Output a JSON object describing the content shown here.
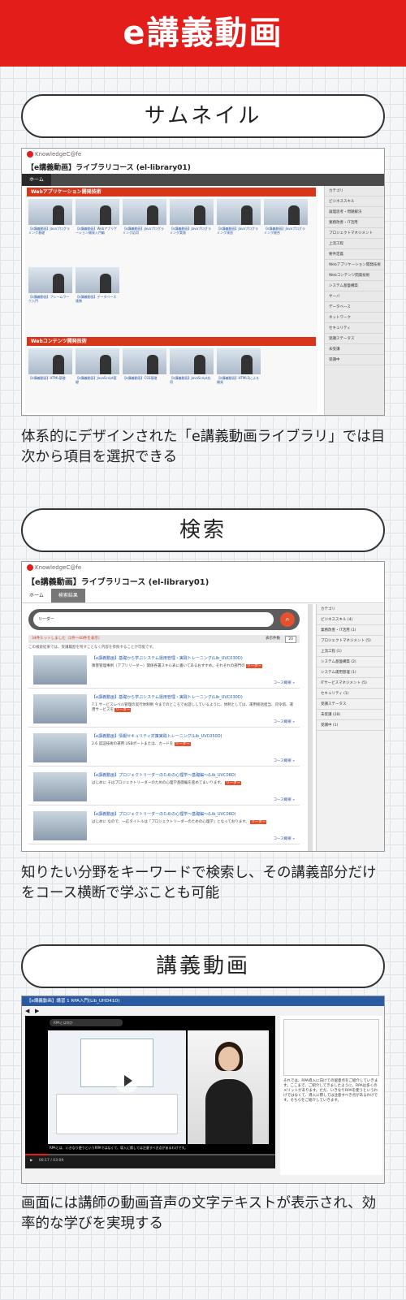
{
  "page": {
    "title": "e講義動画",
    "accent": "#e31d1a"
  },
  "sections": [
    {
      "heading": "サムネイル",
      "caption": "体系的にデザインされた「e講義動画ライブラリ」では目次から項目を選択できる"
    },
    {
      "heading": "検索",
      "caption": "知りたい分野をキーワードで検索し、その講義部分だけをコース横断で学ぶことも可能"
    },
    {
      "heading": "講義動画",
      "caption": "画面には講師の動画音声の文字テキストが表示され、効率的な学びを実現する"
    }
  ],
  "screen1": {
    "brand": "KnowledgeC@fe",
    "course_title": "【e講義動画】ライブラリコース (el-library01)",
    "tab_home": "ホーム",
    "section_a": "Webアプリケーション開発技術",
    "section_b": "Webコンテンツ開発技術",
    "thumbs_a": [
      "【e講義動画】Javaプログラミング基礎",
      "【e講義動画】Webアプリケーション開発入門編",
      "【e講義動画】Javaプログラミング応用",
      "【e講義動画】Javaプログラミング実践",
      "【e講義動画】Javaプログラミング演習",
      "【e講義動画】Javaプログラミング総合",
      "【e講義動画】フレームワーク入門",
      "【e講義動画】データベース連携"
    ],
    "thumbs_b": [
      "【e講義動画】HTML基礎",
      "【e講義動画】JavaScript基礎",
      "【e講義動画】CSS基礎",
      "【e講義動画】JavaScript応用",
      "【e講義動画】HTML5による開発"
    ],
    "sidebar": [
      "カテゴリ",
      "ビジネススキル",
      "論理思考・問題解決",
      "業務改善・IT活用",
      "プロジェクトマネジメント",
      "上流工程",
      "要件定義",
      "Webアプリケーション開発技術",
      "Webコンテンツ開発技術",
      "システム基盤構築",
      "サーバ",
      "データベース",
      "ネットワーク",
      "セキュリティ",
      "受講ステータス",
      "未受講",
      "受講中"
    ]
  },
  "screen2": {
    "brand": "KnowledgeC@fe",
    "course_title": "【e講義動画】ライブラリコース (el-library01)",
    "tab_home": "ホーム",
    "tab_results": "検索結果",
    "search_value": "リーダー",
    "result_count": "34件ヒットしました（1件～40件を表示）",
    "display_count_label": "表示件数",
    "display_count": "20",
    "note": "この検索結果では、受講履歴を残すことなく内容を参照することが可能です。",
    "rows": [
      {
        "title": "【e講義動画】基礎から学ぶシステム運用管理・実践トレーニング(Lib_UVC030D)",
        "text": "障害管理事例（アプリリーダー）関係各署スキル表に書いてあるおすすめ。それぞれの部門の",
        "hl": "リーダー",
        "link": "コース概要 »"
      },
      {
        "title": "【e講義動画】基礎から学ぶシステム運用管理・実践トレーニング(Lib_UVC030D)",
        "text": "7.1 サービスレベル管理の実行体制例 今までのところでお話ししているように、体制としては、運用統括担当、司令塔、運用サービスを",
        "hl": "リーダー",
        "link": "コース概要 »"
      },
      {
        "title": "【e講義動画】情報セキュリティ対策実践トレーニング(Lib_UVC050D)",
        "text": "2.6 認証技術の運用 USBポートまたは、カードを",
        "hl": "リーダー",
        "link": "コース概要 »"
      },
      {
        "title": "【e講義動画】プロジェクトリーダーのための心理学～基礎編～(Lib_UVC06D)",
        "text": "はじめに そはプロジェクトリーダーのための心理学基礎編を進めてまいります。",
        "hl": "リーダー",
        "link": "コース概要 »"
      },
      {
        "title": "【e講義動画】プロジェクトリーダーのための心理学～基礎編～(Lib_UVC06D)",
        "text": "はじめに なので、一応タイトルは「プロジェクトリーダーのための心理学」となっております。",
        "hl": "リーダー",
        "link": "コース概要 »"
      }
    ],
    "sidebar": [
      "カテゴリ",
      "ビジネススキル (4)",
      "業務改善・IT活用 (1)",
      "プロジェクトマネジメント (5)",
      "上流工程 (1)",
      "システム基盤構築 (2)",
      "システム運用管理 (1)",
      "ITサービスマネジメント (5)",
      "セキュリティ (1)",
      "受講ステータス",
      "未受講 (28)",
      "受講中 (1)"
    ]
  },
  "screen3": {
    "top_title": "【e講義動画】講習 1 RPA入門(Lib_UHD41D)",
    "subtitle": "RPAとは何か",
    "time": "00:17 / 03:09",
    "caption_line": "RPAとは、いきなり使うというRPAではなくて、導入に際しては注意すべき点があるわけです。",
    "transcript": "それでは、RPA導入に向けての留意点をご紹介していきます。ここまで、ご紹介してきましたように、RPAは多くのメリットがあります。ただ、いきなりRPAを使うというわけではなくて、導入に際しては注意すべき点があるわけです。そちらをご紹介していきます。"
  }
}
